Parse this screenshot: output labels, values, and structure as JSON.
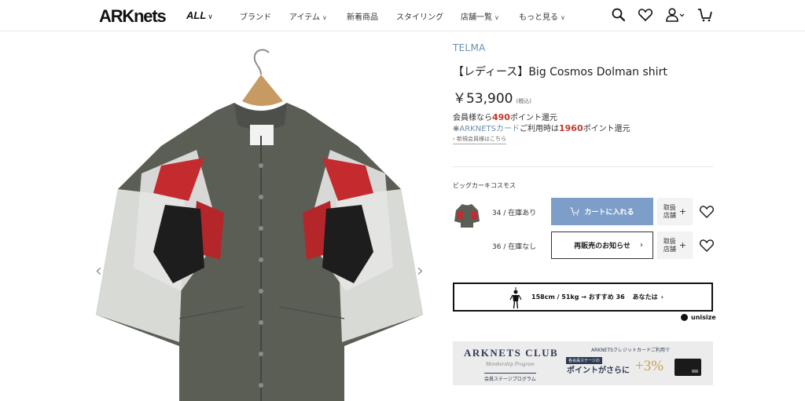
{
  "header": {
    "logo": "ARKnets",
    "all_label": "ALL",
    "nav": [
      {
        "label": "ブランド",
        "has_menu": false
      },
      {
        "label": "アイテム",
        "has_menu": true
      },
      {
        "label": "新着商品",
        "has_menu": false
      },
      {
        "label": "スタイリング",
        "has_menu": false
      },
      {
        "label": "店舗一覧",
        "has_menu": true
      },
      {
        "label": "もっと見る",
        "has_menu": true
      }
    ],
    "icons": [
      "search-icon",
      "heart-icon",
      "user-icon",
      "cart-icon"
    ]
  },
  "gallery": {
    "prev_arrow": "‹",
    "next_arrow": "›"
  },
  "product": {
    "brand": "TELMA",
    "title": "【レディース】Big Cosmos Dolman shirt",
    "price": "￥53,900",
    "tax_note": "(税込)",
    "points_line1_prefix": "会員様なら",
    "points_line1_value": "490",
    "points_line1_suffix": "ポイント還元",
    "points_line2_prefix": "※",
    "points_line2_card": "ARKNETSカード",
    "points_line2_mid": "ご利用時は",
    "points_line2_value": "1960",
    "points_line2_suffix": "ポイント還元",
    "register_link": "新規会員様はこちら",
    "color_name": "ビッグカーキコスモス"
  },
  "variants": [
    {
      "size": "34 / 在庫あり",
      "button": "カートに入れる",
      "store": "取扱\n店舗"
    },
    {
      "size": "36 / 在庫なし",
      "button": "再販売のお知らせ",
      "store": "取扱\n店舗"
    }
  ],
  "fit": {
    "text": "158cm / 51kg → おすすめ 36",
    "you": "あなたは",
    "provider": "unisize"
  },
  "banner": {
    "club": "ARKNETS CLUB",
    "script": "Membership Program",
    "stage": "会員ステージプログラム",
    "card_text": "ARKNETSクレジットカードご利用で",
    "stage_badge": "各会員ステージの",
    "points_text": "ポイントがさらに",
    "plus": "+3%"
  },
  "colors": {
    "accent_blue": "#7d9ec9",
    "brand_blue": "#6a8fb0",
    "points_red": "#c0392b",
    "banner_bg": "#ececec"
  }
}
